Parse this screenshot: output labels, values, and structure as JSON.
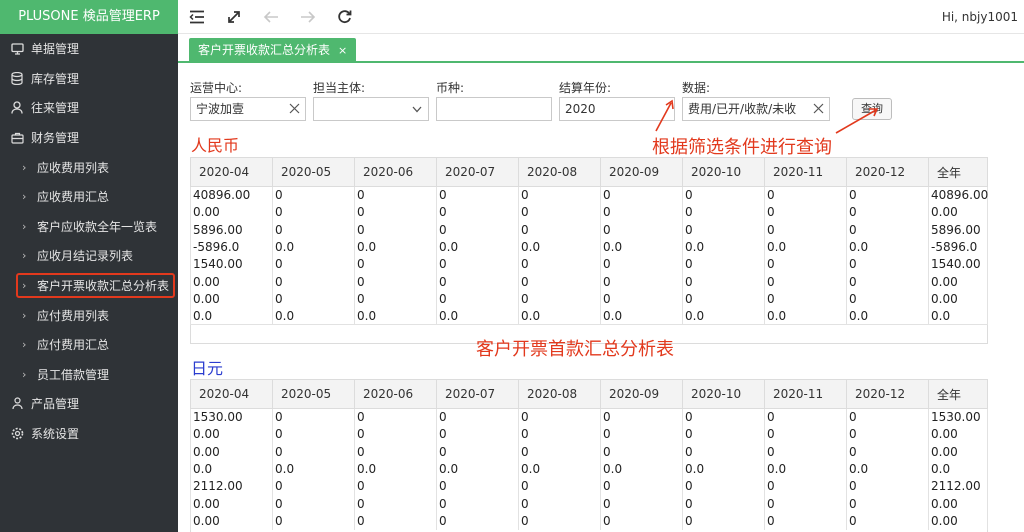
{
  "app": {
    "brand": "PLUSONE 検品管理ERP",
    "user_greeting": "Hi, nbjy1001"
  },
  "sidebar": {
    "items": [
      {
        "label": "单据管理",
        "icon": "monitor-icon",
        "level": "top"
      },
      {
        "label": "库存管理",
        "icon": "database-icon",
        "level": "top"
      },
      {
        "label": "往来管理",
        "icon": "user-icon",
        "level": "top"
      },
      {
        "label": "财务管理",
        "icon": "briefcase-icon",
        "level": "top"
      },
      {
        "label": "应收费用列表",
        "level": "sub"
      },
      {
        "label": "应收费用汇总",
        "level": "sub"
      },
      {
        "label": "客户应收款全年一览表",
        "level": "sub"
      },
      {
        "label": "应收月结记录列表",
        "level": "sub"
      },
      {
        "label": "客户开票收款汇总分析表",
        "level": "sub",
        "active": true
      },
      {
        "label": "应付费用列表",
        "level": "sub"
      },
      {
        "label": "应付费用汇总",
        "level": "sub"
      },
      {
        "label": "员工借款管理",
        "level": "sub"
      },
      {
        "label": "产品管理",
        "icon": "group-icon",
        "level": "top"
      },
      {
        "label": "系统设置",
        "icon": "gear-icon",
        "level": "top"
      }
    ]
  },
  "toolbar": {
    "icons": [
      "collapse-menu-icon",
      "fullscreen-icon",
      "back-icon",
      "forward-icon",
      "refresh-icon"
    ]
  },
  "tabs": [
    {
      "label": "客户开票收款汇总分析表",
      "close": "×"
    }
  ],
  "filters": {
    "center": {
      "label": "运营中心:",
      "value": "宁波加壹"
    },
    "entity": {
      "label": "担当主体:",
      "value": ""
    },
    "currency": {
      "label": "币种:",
      "value": ""
    },
    "year": {
      "label": "结算年份:",
      "value": "2020"
    },
    "data": {
      "label": "数据:",
      "value": "费用/已开/收款/未收"
    },
    "query_label": "查询"
  },
  "annotations": {
    "query_hint": "根据筛选条件进行查询",
    "table_hint": "客户开票首款汇总分析表"
  },
  "sections": {
    "rmb": {
      "title": "人民币",
      "headers": [
        "2020-04",
        "2020-05",
        "2020-06",
        "2020-07",
        "2020-08",
        "2020-09",
        "2020-10",
        "2020-11",
        "2020-12",
        "全年"
      ],
      "rows": [
        [
          "40896.00",
          "0",
          "0",
          "0",
          "0",
          "0",
          "0",
          "0",
          "0",
          "40896.00"
        ],
        [
          "0.00",
          "0",
          "0",
          "0",
          "0",
          "0",
          "0",
          "0",
          "0",
          "0.00"
        ],
        [
          "5896.00",
          "0",
          "0",
          "0",
          "0",
          "0",
          "0",
          "0",
          "0",
          "5896.00"
        ],
        [
          "-5896.0",
          "0.0",
          "0.0",
          "0.0",
          "0.0",
          "0.0",
          "0.0",
          "0.0",
          "0.0",
          "-5896.0"
        ],
        [
          "1540.00",
          "0",
          "0",
          "0",
          "0",
          "0",
          "0",
          "0",
          "0",
          "1540.00"
        ],
        [
          "0.00",
          "0",
          "0",
          "0",
          "0",
          "0",
          "0",
          "0",
          "0",
          "0.00"
        ],
        [
          "0.00",
          "0",
          "0",
          "0",
          "0",
          "0",
          "0",
          "0",
          "0",
          "0.00"
        ],
        [
          "0.0",
          "0.0",
          "0.0",
          "0.0",
          "0.0",
          "0.0",
          "0.0",
          "0.0",
          "0.0",
          "0.0"
        ]
      ]
    },
    "jpy": {
      "title": "日元",
      "headers": [
        "2020-04",
        "2020-05",
        "2020-06",
        "2020-07",
        "2020-08",
        "2020-09",
        "2020-10",
        "2020-11",
        "2020-12",
        "全年"
      ],
      "rows": [
        [
          "1530.00",
          "0",
          "0",
          "0",
          "0",
          "0",
          "0",
          "0",
          "0",
          "1530.00"
        ],
        [
          "0.00",
          "0",
          "0",
          "0",
          "0",
          "0",
          "0",
          "0",
          "0",
          "0.00"
        ],
        [
          "0.00",
          "0",
          "0",
          "0",
          "0",
          "0",
          "0",
          "0",
          "0",
          "0.00"
        ],
        [
          "0.0",
          "0.0",
          "0.0",
          "0.0",
          "0.0",
          "0.0",
          "0.0",
          "0.0",
          "0.0",
          "0.0"
        ],
        [
          "2112.00",
          "0",
          "0",
          "0",
          "0",
          "0",
          "0",
          "0",
          "0",
          "2112.00"
        ],
        [
          "0.00",
          "0",
          "0",
          "0",
          "0",
          "0",
          "0",
          "0",
          "0",
          "0.00"
        ],
        [
          "0.00",
          "0",
          "0",
          "0",
          "0",
          "0",
          "0",
          "0",
          "0",
          "0.00"
        ]
      ]
    }
  },
  "colors": {
    "accent": "#4fb86f",
    "sidebar_bg": "#2f3337",
    "rmb_title": "#e2391d",
    "jpy_title": "#2a3ccf",
    "annotation": "#e2391d"
  }
}
